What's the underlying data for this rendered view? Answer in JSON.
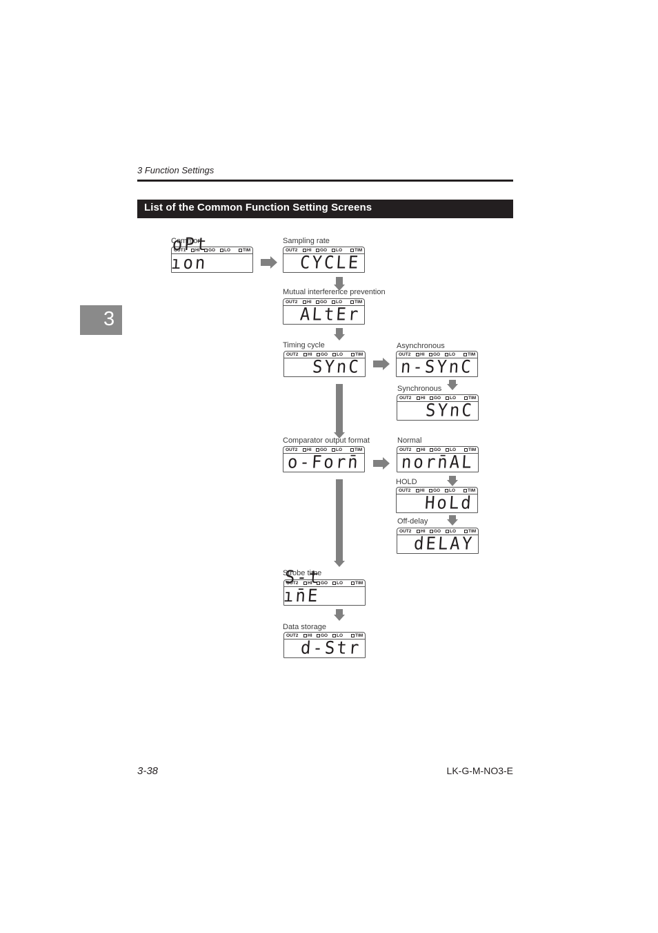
{
  "header": {
    "running_head": "3  Function Settings",
    "section_title": "List of the Common Function Setting Screens",
    "chapter_tab": "3"
  },
  "footer": {
    "page_number": "3-38",
    "document_code": "LK-G-M-NO3-E"
  },
  "lcd_indicators": {
    "hi": "HI",
    "go": "GO",
    "lo": "LO",
    "tim": "TIM"
  },
  "screens": {
    "common": {
      "label": "Common",
      "out": "OUT1",
      "display": "oPt ıon"
    },
    "sampling": {
      "label": "Sampling rate",
      "out": "OUT2",
      "display": "CYCLE"
    },
    "mutual": {
      "label": "Mutual interference prevention",
      "out": "OUT2",
      "display": "ALtEr"
    },
    "timing": {
      "label": "Timing cycle",
      "out": "OUT2",
      "display": "SYnC"
    },
    "async": {
      "label": "Asynchronous",
      "out": "OUT2",
      "display": "n-SYnC"
    },
    "sync": {
      "label": "Synchronous",
      "out": "OUT2",
      "display": "SYnC"
    },
    "comparator": {
      "label": "Comparator output format",
      "out": "OUT2",
      "display": "o-Forn̄"
    },
    "normal": {
      "label": "Normal",
      "out": "OUT2",
      "display": "norn̄AL"
    },
    "hold": {
      "label": "HOLD",
      "out": "OUT2",
      "display": "HoLd"
    },
    "offdelay": {
      "label": "Off-delay",
      "out": "OUT2",
      "display": "dELAY"
    },
    "strobe": {
      "label": "Strobe time",
      "out": "OUT2",
      "display": "S-t ın̄E"
    },
    "datastorage": {
      "label": "Data storage",
      "out": "OUT2",
      "display": "d-Str"
    }
  },
  "colors": {
    "section_bar": "#231f20",
    "arrow": "#808080",
    "chapter_tab": "#8a8a8a"
  }
}
